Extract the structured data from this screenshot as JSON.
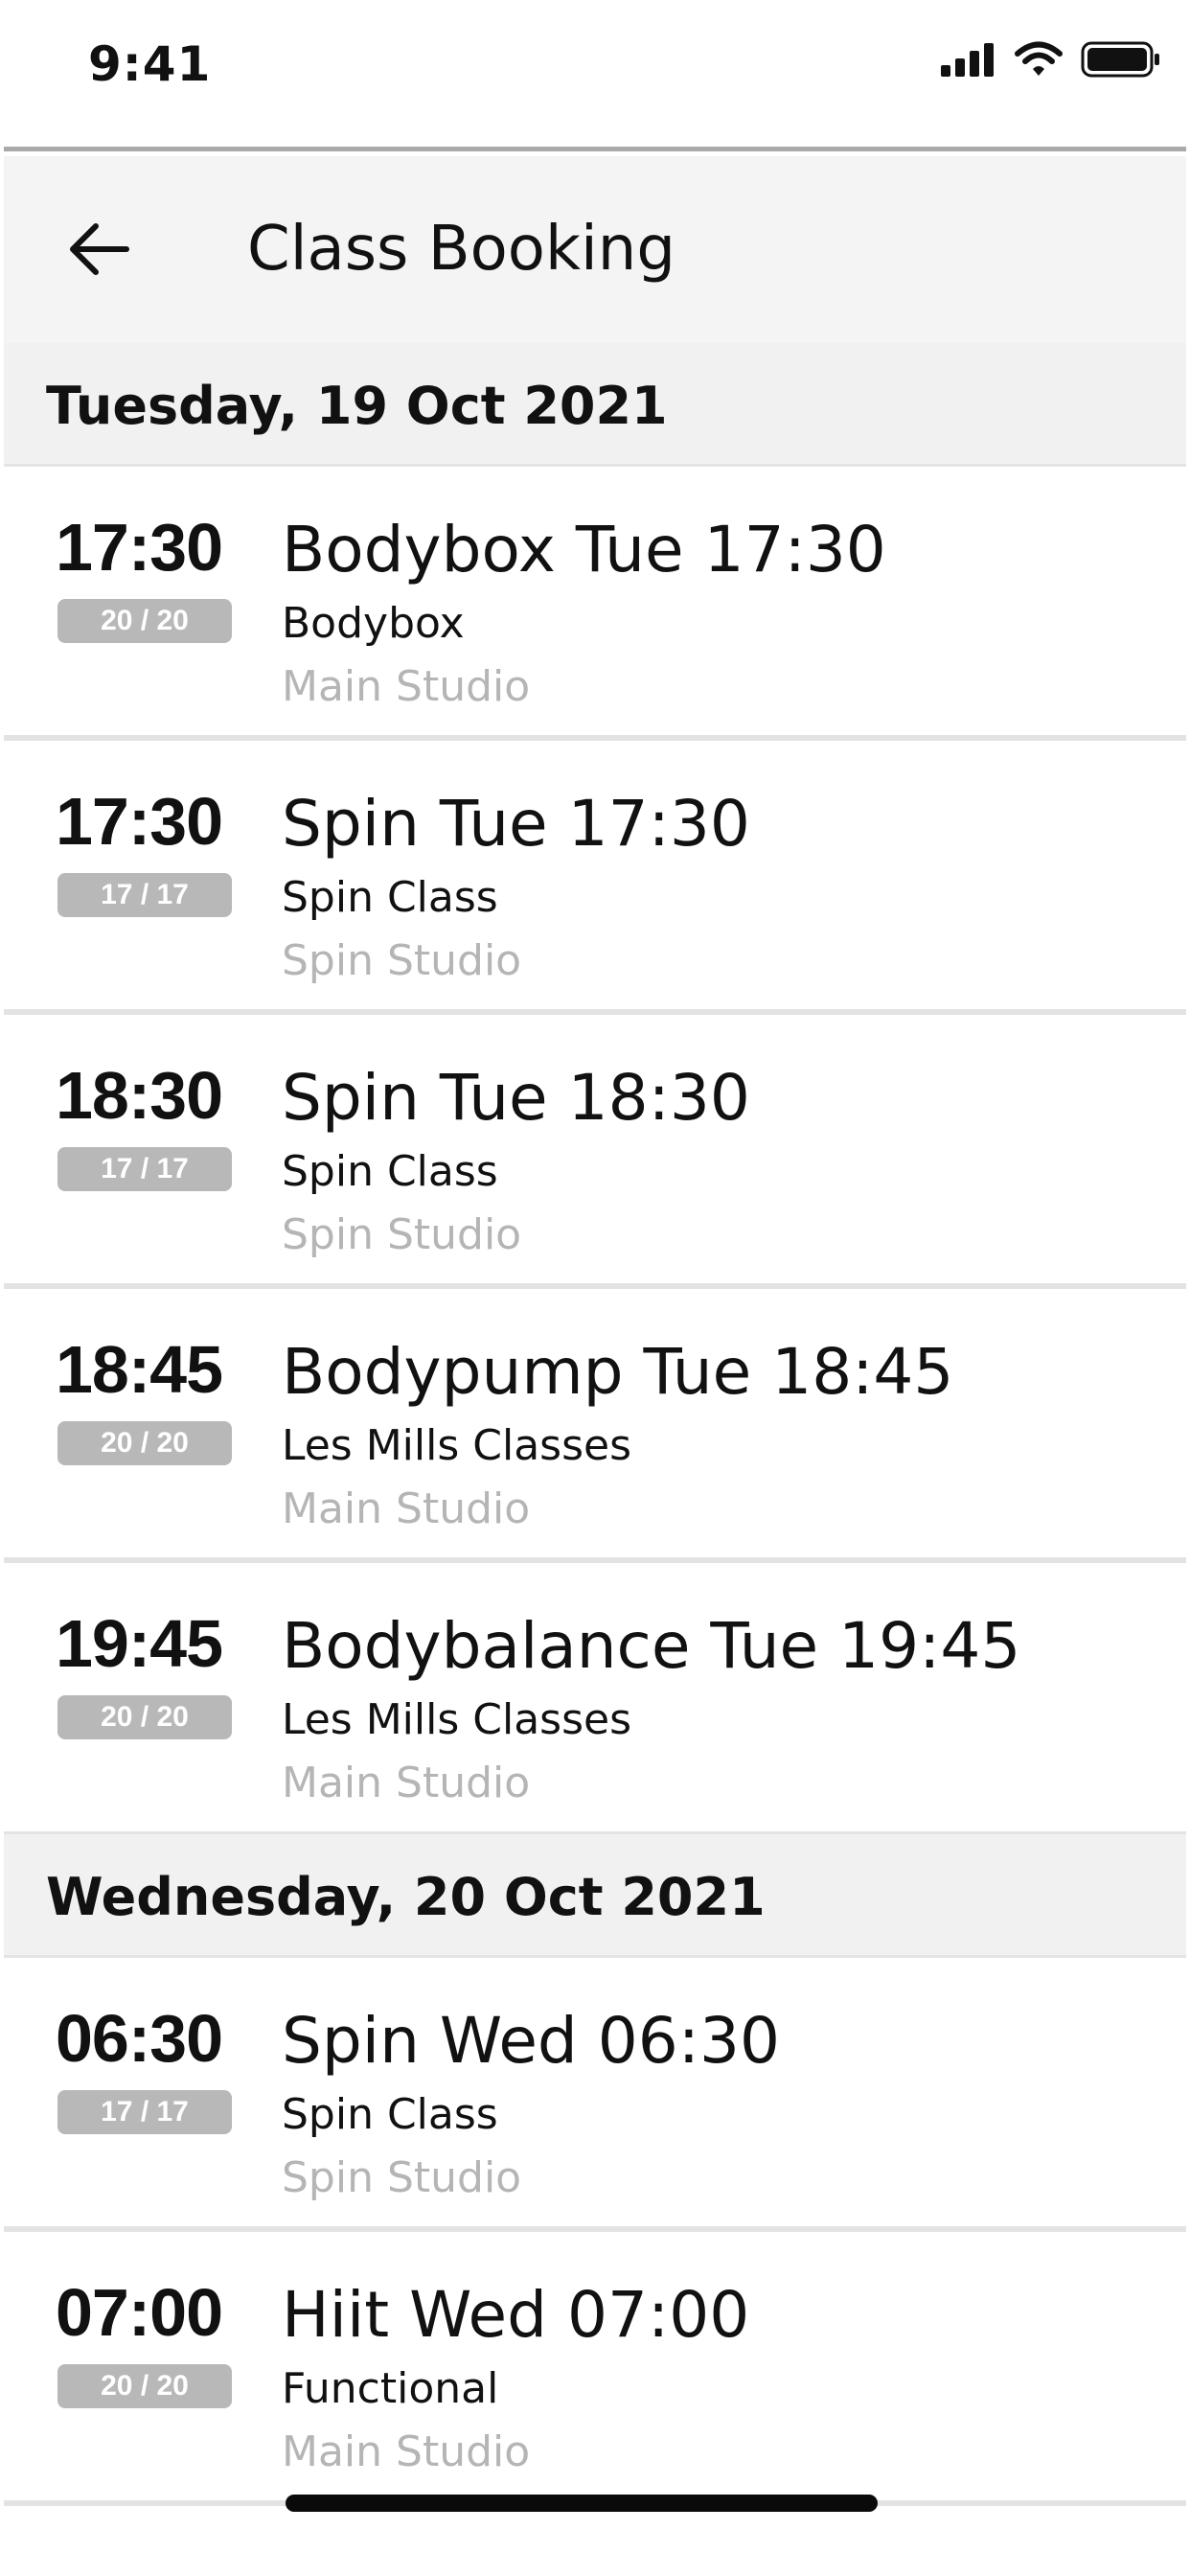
{
  "status_bar": {
    "time": "9:41",
    "icons": [
      "cellular-signal-icon",
      "wifi-icon",
      "battery-icon"
    ]
  },
  "app_bar": {
    "back_icon": "arrow-left-icon",
    "title": "Class Booking"
  },
  "days": [
    {
      "label": "Tuesday, 19 Oct 2021",
      "classes": [
        {
          "time": "17:30",
          "capacity": "20 / 20",
          "name": "Bodybox Tue 17:30",
          "category": "Bodybox",
          "location": "Main Studio"
        },
        {
          "time": "17:30",
          "capacity": "17 / 17",
          "name": "Spin Tue 17:30",
          "category": "Spin Class",
          "location": "Spin Studio"
        },
        {
          "time": "18:30",
          "capacity": "17 / 17",
          "name": "Spin Tue 18:30",
          "category": "Spin Class",
          "location": "Spin Studio"
        },
        {
          "time": "18:45",
          "capacity": "20 / 20",
          "name": "Bodypump Tue 18:45",
          "category": "Les Mills Classes",
          "location": "Main Studio"
        },
        {
          "time": "19:45",
          "capacity": "20 / 20",
          "name": "Bodybalance Tue 19:45",
          "category": "Les Mills Classes",
          "location": "Main Studio"
        }
      ]
    },
    {
      "label": "Wednesday, 20 Oct 2021",
      "classes": [
        {
          "time": "06:30",
          "capacity": "17 / 17",
          "name": "Spin Wed 06:30",
          "category": "Spin Class",
          "location": "Spin Studio"
        },
        {
          "time": "07:00",
          "capacity": "20 / 20",
          "name": "Hiit Wed 07:00",
          "category": "Functional",
          "location": "Main Studio"
        }
      ]
    }
  ],
  "colors": {
    "app_bar_bg": "#f4f4f4",
    "day_header_bg": "#f1f1f1",
    "capacity_badge_bg": "#b8b8b8",
    "location_text": "#b5b5b5",
    "divider": "#e3e3e3"
  }
}
